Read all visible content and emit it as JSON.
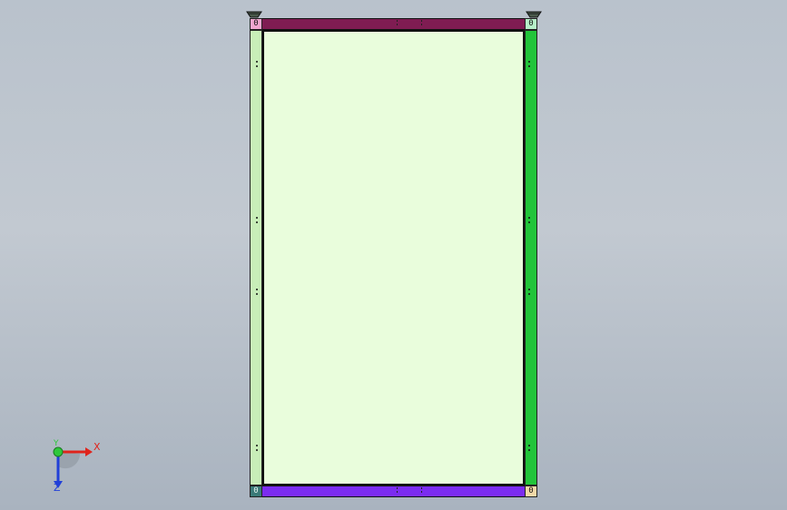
{
  "colors": {
    "background_top": "#b9c2cc",
    "background_bottom": "#a9b3bf",
    "panel_fill": "#e9fddc",
    "top_beam": "#7f1c52",
    "bottom_beam": "#7b2cf0",
    "left_post": "#c8eeb8",
    "right_post": "#22c43a",
    "corner_top_left": "#f2a6d0",
    "corner_top_right": "#b6f0c8",
    "corner_bottom_left": "#3a7a78",
    "corner_bottom_right": "#f3d9a8",
    "axis_x": "#e0241c",
    "axis_y": "#2ec83a",
    "axis_z": "#2140d8"
  },
  "model": {
    "corner_labels": {
      "top_left": "0",
      "top_right": "0",
      "bottom_left": "0",
      "bottom_right": "0"
    }
  },
  "triad": {
    "x_label": "X",
    "y_label": "Y",
    "z_label": "Z"
  },
  "icons": {
    "triad": "coordinate-triad-icon",
    "leveling_foot": "leveling-foot-icon"
  }
}
